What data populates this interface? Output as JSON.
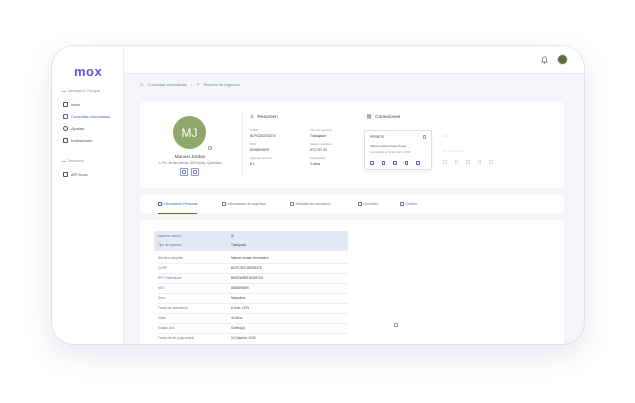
{
  "app": {
    "logo": "mox"
  },
  "sidebar": {
    "section_nav": "Navegación Principal",
    "items": [
      {
        "label": "Inicio",
        "icon": "home-icon"
      },
      {
        "label": "Consultas conectadas",
        "icon": "link-icon",
        "active": true
      },
      {
        "label": "Ajustes",
        "icon": "gear-icon"
      },
      {
        "label": "Invitaciones",
        "icon": "users-icon"
      }
    ],
    "section_dev": "Desarrollo",
    "dev_items": [
      {
        "label": "API Docs",
        "icon": "code-icon"
      }
    ]
  },
  "topbar": {
    "bell": "bell-icon",
    "avatar": "user-avatar"
  },
  "breadcrumb": {
    "parent": "Consultas conectadas",
    "current": "Reporte de ingresos"
  },
  "profile": {
    "initials": "MJ",
    "name": "Manuel Jordan",
    "location": "Pto. de las palmas 169 Pueblo, Querétaro",
    "avatar_color": "#8fa86a"
  },
  "resumen": {
    "title": "Resumen",
    "fields": [
      {
        "label": "CURP",
        "value": "BLPS230378376"
      },
      {
        "label": "Tipo de ingresos",
        "value": "Trabajador"
      },
      {
        "label": "NSS",
        "value": "8006893699"
      },
      {
        "label": "Salario mensual",
        "value": "$73,767.00"
      },
      {
        "label": "Ingresos activos",
        "value": "$ 1"
      },
      {
        "label": "Antigüedad",
        "value": "2 años"
      }
    ]
  },
  "conexiones": {
    "title": "Conexiones",
    "active": {
      "name": "PERIETE",
      "desc": "Ultima revisión hace 8 mes",
      "date": "Consultado el 31 de marzo 2023"
    },
    "ghost": {
      "name": "SAT",
      "desc": "Sin conexión aún"
    }
  },
  "tabs": [
    {
      "label": "Información Personal",
      "active": true
    },
    {
      "label": "Información de Ingresos"
    },
    {
      "label": "Historial de cotización"
    },
    {
      "label": "Domicilio"
    },
    {
      "label": "Crédito"
    }
  ],
  "details": [
    {
      "key": "Ingresos activos",
      "value": "Si"
    },
    {
      "key": "Tipo de ingresos",
      "value": "Trabajador"
    },
    {
      "key": "Nombre completo",
      "value": "Manuel Jordan Hernandez"
    },
    {
      "key": "CURP",
      "value": "BLPS780718SDB376"
    },
    {
      "key": "RFC Homoclave",
      "value": "BMS2WR5TMVBE705"
    },
    {
      "key": "NSS",
      "value": "8006893699"
    },
    {
      "key": "Sexo",
      "value": "Masculino"
    },
    {
      "key": "Fecha de nacimiento",
      "value": "8 Julio, 1979"
    },
    {
      "key": "Edad",
      "value": "44 Años"
    },
    {
      "key": "Estado civil",
      "value": "Soltero(a)"
    },
    {
      "key": "Fecha de últ. pago actual",
      "value": "10 Octubre, 2005"
    }
  ],
  "colors": {
    "accent": "#4b5bd6",
    "logo": "#6b4fd8",
    "highlight": "#e6e8f8"
  }
}
